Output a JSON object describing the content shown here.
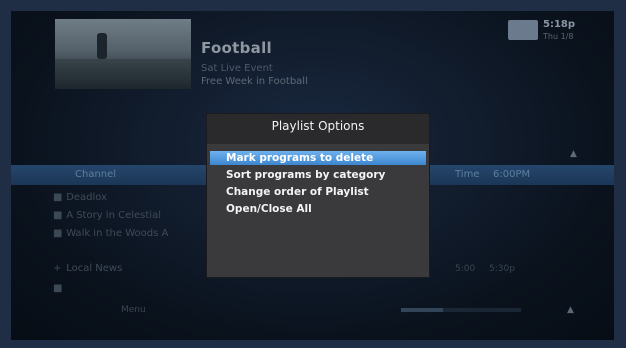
{
  "program": {
    "title": "Football",
    "line1": "Sat  Live Event",
    "line2": "Free Week in Football"
  },
  "clock": {
    "time": "5:18p",
    "date": "Thu 1/8"
  },
  "list": {
    "header_left": "Channel",
    "header_time": "Time",
    "header_right": "6:00PM",
    "items": [
      {
        "icon": "■",
        "label": "Deadlox"
      },
      {
        "icon": "■",
        "label": "A Story in Celestial"
      },
      {
        "icon": "■",
        "label": "Walk in the Woods A"
      },
      {
        "icon": "+",
        "label": "Local News"
      },
      {
        "icon": "■",
        "label": ""
      }
    ],
    "local_news_time": "5:00",
    "local_news_time2": "5:30p"
  },
  "footer": {
    "hint": "Menu",
    "indicator": "▲"
  },
  "dialog": {
    "title": "Playlist Options",
    "options": [
      {
        "label": "Mark programs to delete",
        "selected": true
      },
      {
        "label": "Sort programs by category",
        "selected": false
      },
      {
        "label": "Change order of Playlist",
        "selected": false
      },
      {
        "label": "Open/Close All",
        "selected": false
      }
    ]
  },
  "progress": 0.35,
  "colors": {
    "highlight": "#4a94dc",
    "dialog_bg": "#3a3a3d",
    "screen_bg": "#0b1522"
  }
}
